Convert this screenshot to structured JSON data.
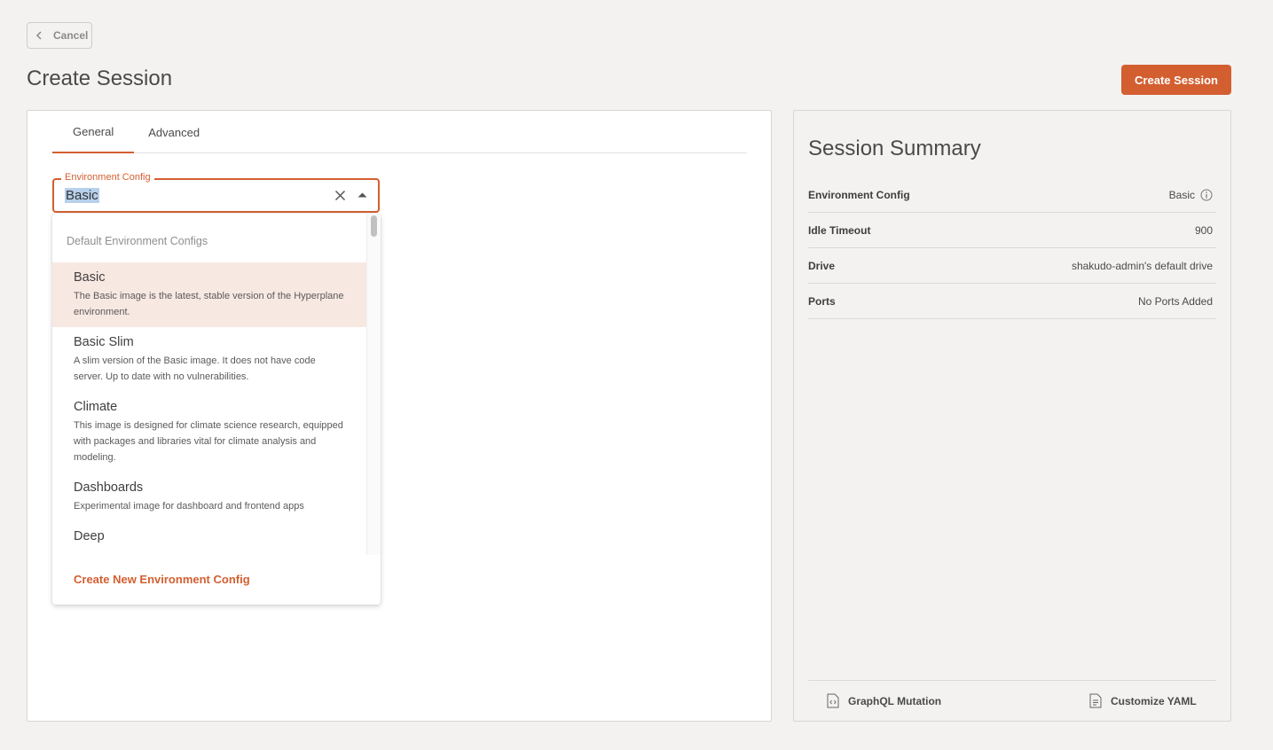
{
  "header": {
    "cancel_label": "Cancel",
    "title": "Create Session",
    "create_label": "Create Session"
  },
  "tabs": [
    {
      "label": "General",
      "active": true
    },
    {
      "label": "Advanced",
      "active": false
    }
  ],
  "env_field": {
    "label": "Environment Config",
    "value": "Basic"
  },
  "dropdown": {
    "group_header": "Default Environment Configs",
    "options": [
      {
        "name": "Basic",
        "desc": "The Basic image is the latest, stable version of the Hyperplane environment.",
        "selected": true
      },
      {
        "name": "Basic Slim",
        "desc": "A slim version of the Basic image. It does not have code server. Up to date with no vulnerabilities.",
        "selected": false
      },
      {
        "name": "Climate",
        "desc": "This image is designed for climate science research, equipped with packages and libraries vital for climate analysis and modeling.",
        "selected": false
      },
      {
        "name": "Dashboards",
        "desc": "Experimental image for dashboard and frontend apps",
        "selected": false
      },
      {
        "name": "Deep",
        "desc": "",
        "selected": false
      }
    ],
    "create_new_label": "Create New Environment Config"
  },
  "summary": {
    "title": "Session Summary",
    "rows": [
      {
        "key": "Environment Config",
        "value": "Basic"
      },
      {
        "key": "Idle Timeout",
        "value": "900"
      },
      {
        "key": "Drive",
        "value": "shakudo-admin's default drive"
      },
      {
        "key": "Ports",
        "value": "No Ports Added"
      }
    ],
    "graphql_label": "GraphQL Mutation",
    "yaml_label": "Customize YAML"
  },
  "colors": {
    "accent": "#d35f31",
    "selected_bg": "#f8e8e2",
    "page_bg": "#f3f2f0"
  }
}
